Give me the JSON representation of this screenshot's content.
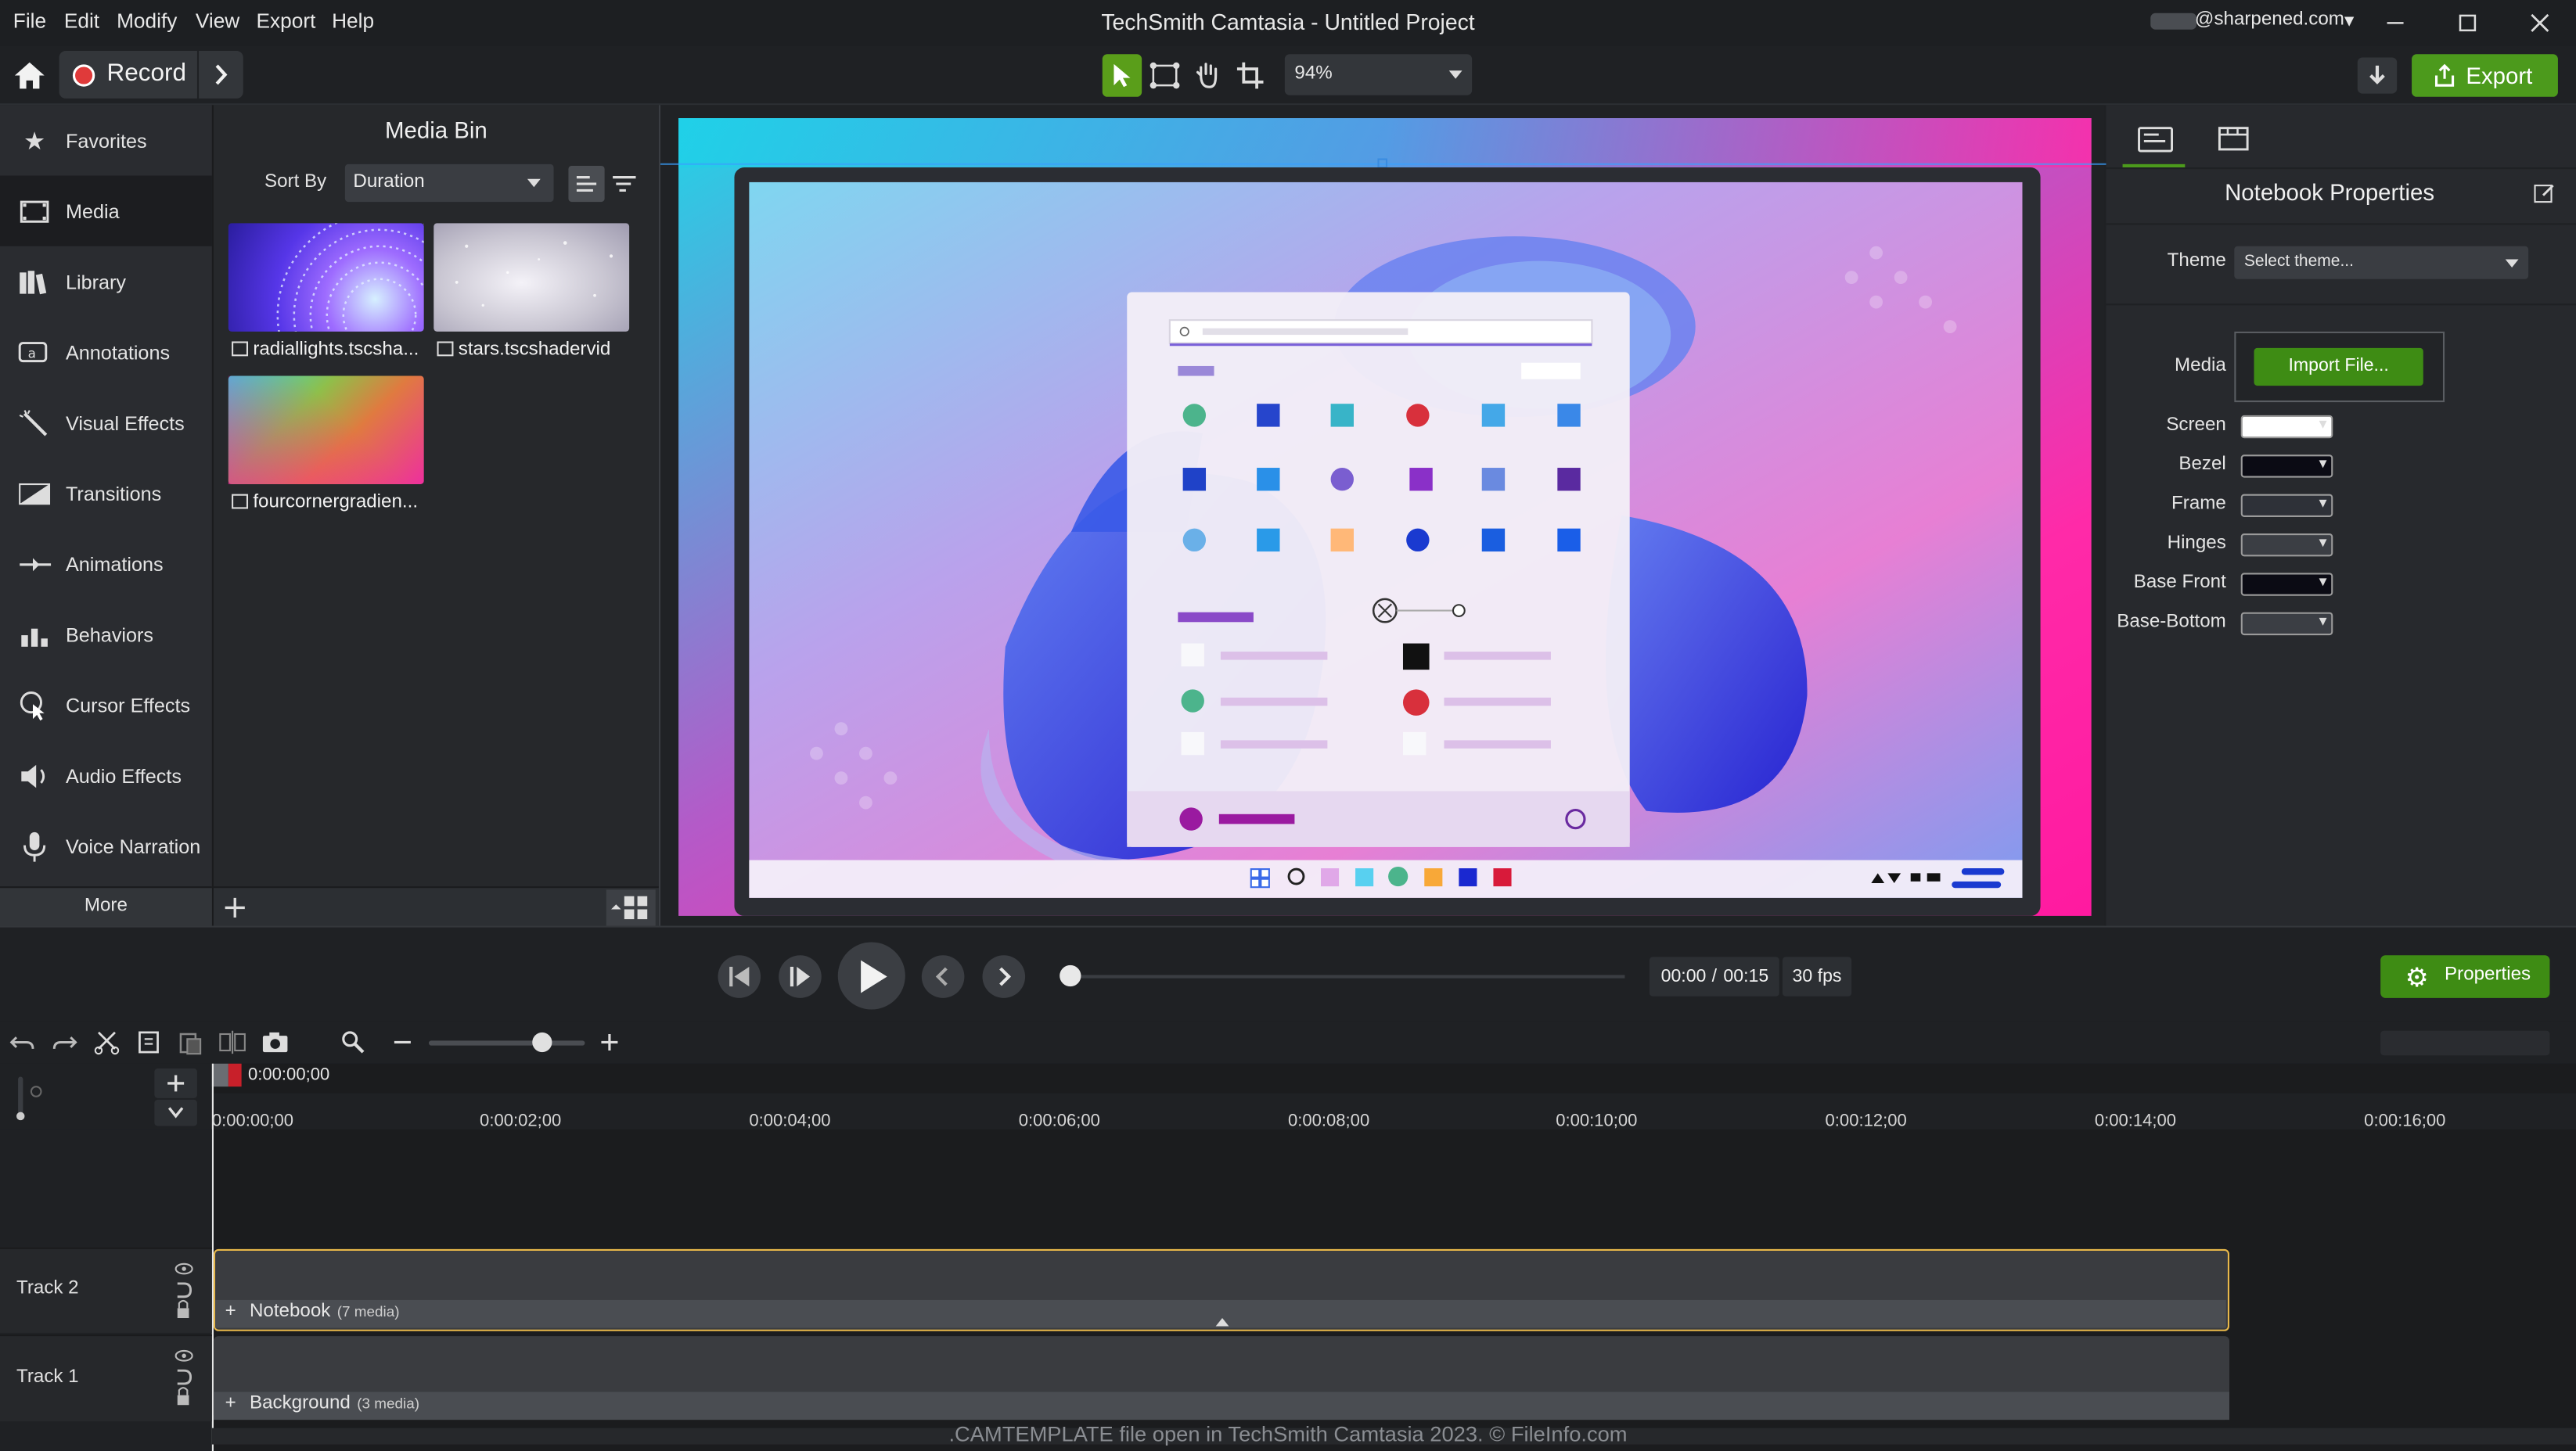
{
  "window": {
    "title": "TechSmith Camtasia - Untitled Project",
    "account": "@sharpened.com",
    "menu": [
      "File",
      "Edit",
      "Modify",
      "View",
      "Export",
      "Help"
    ]
  },
  "toolbar": {
    "record_label": "Record",
    "zoom_value": "94%",
    "export_label": "Export"
  },
  "sidebar": {
    "items": [
      {
        "label": "Favorites",
        "icon": "star-icon"
      },
      {
        "label": "Media",
        "icon": "film-icon"
      },
      {
        "label": "Library",
        "icon": "library-icon"
      },
      {
        "label": "Annotations",
        "icon": "annotation-icon"
      },
      {
        "label": "Visual Effects",
        "icon": "wand-icon"
      },
      {
        "label": "Transitions",
        "icon": "transition-icon"
      },
      {
        "label": "Animations",
        "icon": "animation-icon"
      },
      {
        "label": "Behaviors",
        "icon": "behaviors-icon"
      },
      {
        "label": "Cursor Effects",
        "icon": "cursor-icon"
      },
      {
        "label": "Audio Effects",
        "icon": "speaker-icon"
      },
      {
        "label": "Voice Narration",
        "icon": "microphone-icon"
      }
    ],
    "more_label": "More",
    "selected": "Media"
  },
  "media_bin": {
    "title": "Media Bin",
    "sort_label": "Sort By",
    "sort_value": "Duration",
    "items": [
      {
        "label": "radiallights.tscsha..."
      },
      {
        "label": "stars.tscshadervid"
      },
      {
        "label": "fourcornergradien..."
      }
    ]
  },
  "properties": {
    "title": "Notebook Properties",
    "theme_label": "Theme",
    "theme_value": "Select theme...",
    "media_label": "Media",
    "import_label": "Import File...",
    "colors": [
      {
        "label": "Screen",
        "color": "#ffffff"
      },
      {
        "label": "Bezel",
        "color": "#0b0b14"
      },
      {
        "label": "Frame",
        "color": "#2e3138"
      },
      {
        "label": "Hinges",
        "color": "#3b3e44"
      },
      {
        "label": "Base Front",
        "color": "#0b0b14"
      },
      {
        "label": "Base-Bottom",
        "color": "#3b3e44"
      }
    ],
    "properties_button": "Properties"
  },
  "playback": {
    "time_current": "00:00",
    "time_sep": "/",
    "time_total": "00:15",
    "fps": "30 fps",
    "progress": 0
  },
  "timeline": {
    "playhead_time": "0:00:00;00",
    "ticks": [
      "0:00:00;00",
      "0:00:02;00",
      "0:00:04;00",
      "0:00:06;00",
      "0:00:08;00",
      "0:00:10;00",
      "0:00:12;00",
      "0:00:14;00",
      "0:00:16;00"
    ],
    "tracks": [
      {
        "label": "Track 2",
        "clip": "Notebook",
        "clip_meta": "(7 media)"
      },
      {
        "label": "Track 1",
        "clip": "Background",
        "clip_meta": "(3 media)"
      }
    ]
  },
  "watermark": ".CAMTEMPLATE file open in TechSmith Camtasia 2023. © FileInfo.com",
  "theme_colors": {
    "accent_green": "#4c9a1c",
    "clip_selected": "#e8b84a"
  }
}
